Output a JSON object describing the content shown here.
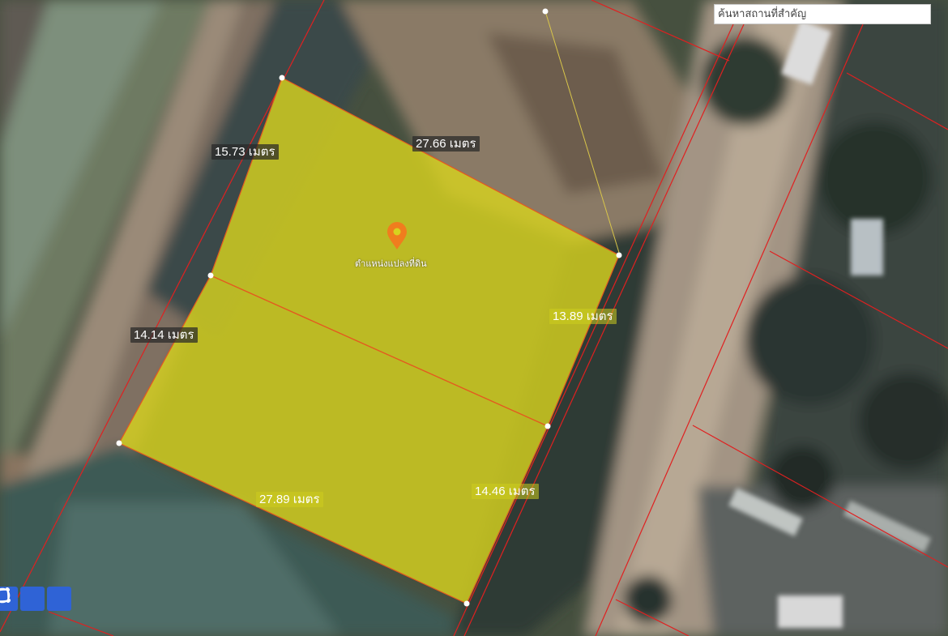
{
  "search": {
    "placeholder": "ค้นหาสถานที่สำคัญ",
    "value": ""
  },
  "marker": {
    "label": "ตำแหน่งแปลงที่ดิน",
    "icon": "map-pin-icon",
    "color": "#f07d1e"
  },
  "measurements": {
    "top": "27.66 เมตร",
    "left_upper": "15.73 เมตร",
    "left_lower": "14.14 เมตร",
    "right_upper": "13.89 เมตร",
    "right_lower": "14.46 เมตร",
    "bottom": "27.89 เมตร"
  },
  "parcel_fill_color": "#d7d21e",
  "boundary_color": "#e02020",
  "tools": [
    {
      "icon": "draw-polygon-icon"
    },
    {
      "icon": "draw-rectangle-icon"
    },
    {
      "icon": "draw-circle-icon"
    }
  ]
}
